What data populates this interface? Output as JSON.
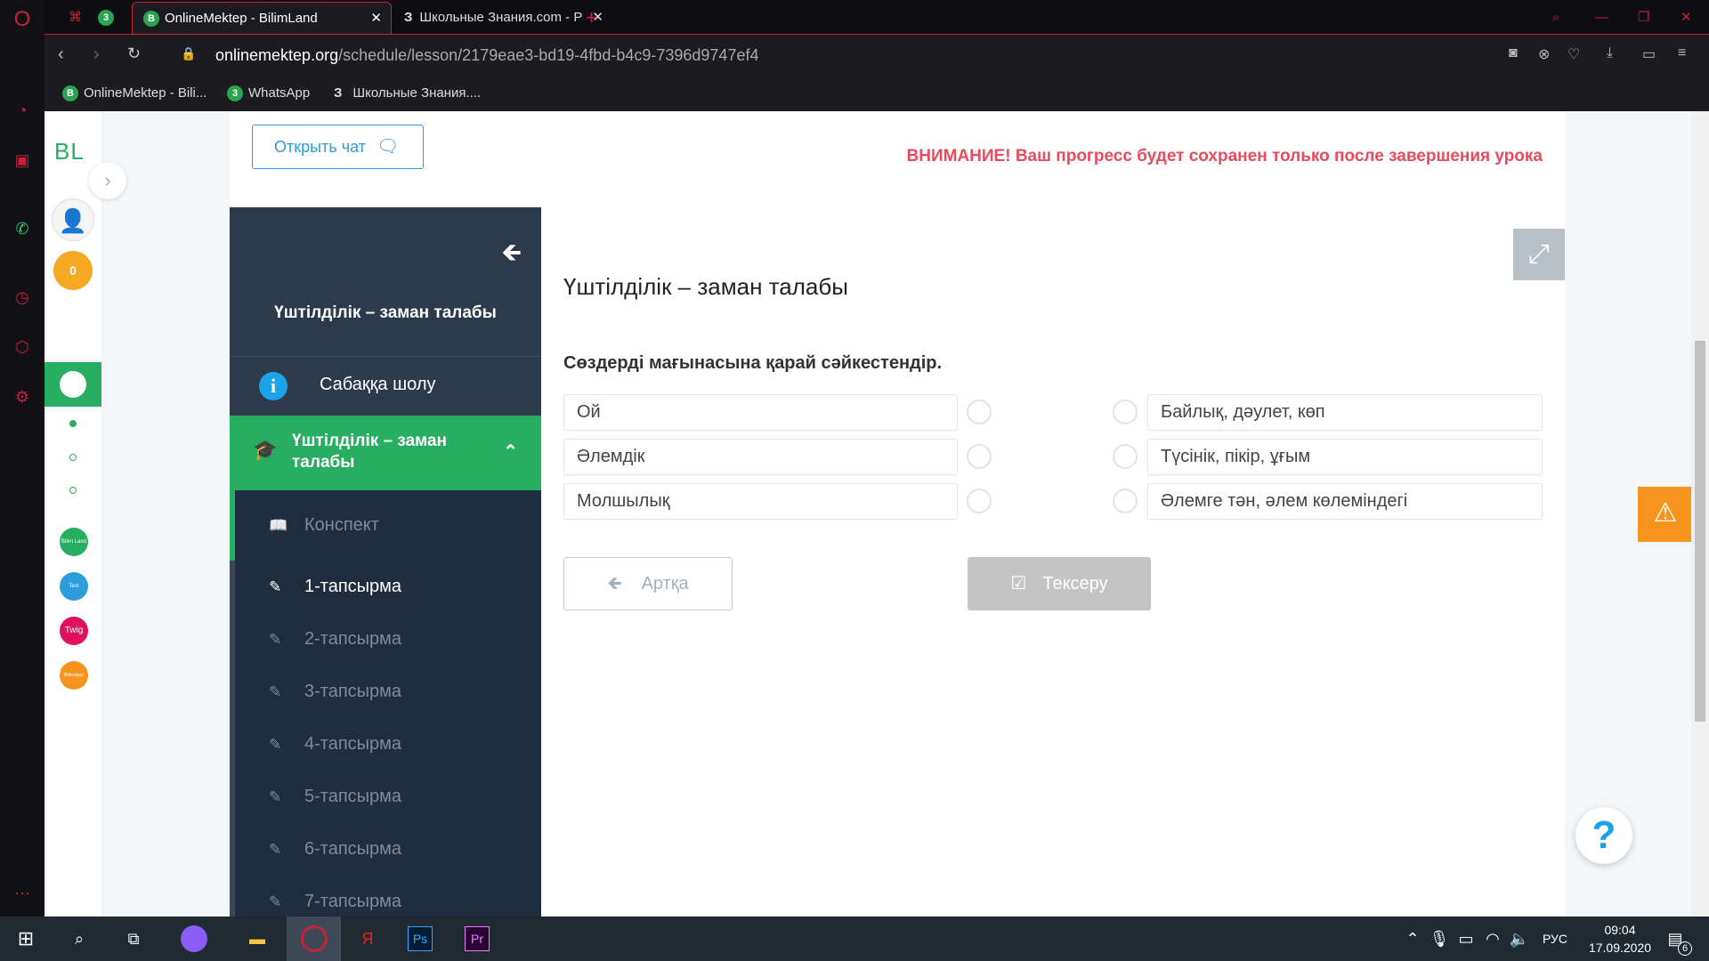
{
  "browser": {
    "tabs": [
      {
        "label": "OnlineMektep - BilimLand",
        "favicon": "B"
      },
      {
        "label": "Школьные Знания.com - Р",
        "favicon": "З"
      }
    ],
    "whatsapp_badge": "3",
    "url_host": "onlinemektep.org",
    "url_path": "/schedule/lesson/2179eae3-bd19-4fbd-b4c9-7396d9747ef4",
    "bookmarks": [
      "OnlineMektep - Bili...",
      "WhatsApp",
      "Школьные Знания...."
    ]
  },
  "bl_sidebar": {
    "logo": "BL",
    "coins": "0",
    "apps": [
      "Bilim Land",
      "Test",
      "Twig",
      "Bilimdays"
    ]
  },
  "header": {
    "open_chat": "Открыть чат",
    "warning": "ВНИМАНИЕ! Ваш прогресс будет сохранен только после завершения урока"
  },
  "menu": {
    "title": "Үштілділік – заман талабы",
    "overview": "Сабаққа шолу",
    "active_section": "Үштілділік – заман талабы",
    "items": [
      "Конспект",
      "1-тапсырма",
      "2-тапсырма",
      "3-тапсырма",
      "4-тапсырма",
      "5-тапсырма",
      "6-тапсырма",
      "7-тапсырма"
    ]
  },
  "content": {
    "title": "Үштілділік – заман талабы",
    "question": "Сөздерді мағынасына қарай сәйкестендір.",
    "left": [
      "Ой",
      "Әлемдік",
      "Молшылық"
    ],
    "right": [
      "Байлық, дәулет, көп",
      "Түсінік, пікір, ұғым",
      "Әлемге тән, әлем көлеміндегі"
    ],
    "back": "Артқа",
    "check": "Тексеру",
    "help": "?"
  },
  "taskbar": {
    "lang": "РУС",
    "time": "09:04",
    "date": "17.09.2020",
    "notifications": "6"
  },
  "colors": {
    "green": "#27ae60",
    "dark": "#2c3a4b",
    "warning": "#e74c5e",
    "orange": "#f7941d"
  }
}
